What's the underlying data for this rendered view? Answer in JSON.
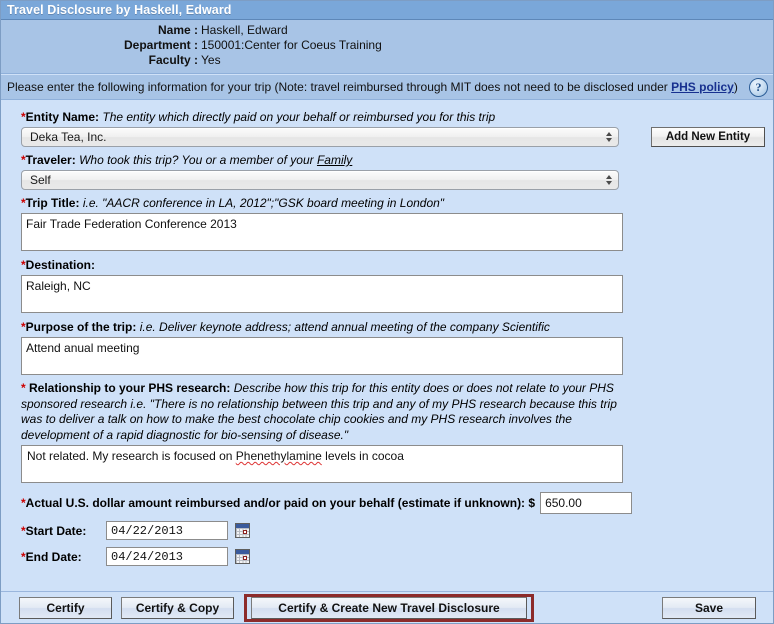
{
  "window": {
    "title": "Travel Disclosure by Haskell, Edward"
  },
  "header": {
    "rows": [
      {
        "label": "Name :",
        "value": "Haskell, Edward"
      },
      {
        "label": "Department :",
        "value": "150001:Center for Coeus Training"
      },
      {
        "label": "Faculty :",
        "value": "Yes"
      }
    ]
  },
  "instruction": {
    "prefix": "Please enter the following information for your trip (Note: travel reimbursed through MIT does not need to be disclosed under ",
    "link": "PHS policy",
    "suffix": ")",
    "help_icon": "question-mark-icon",
    "help_glyph": "?"
  },
  "form": {
    "entity": {
      "required": "*",
      "label": "Entity Name:",
      "hint": "The entity which directly paid on your behalf or reimbursed you for this trip",
      "value": "Deka Tea, Inc.",
      "options": [
        "Deka Tea, Inc."
      ],
      "add_button": "Add New Entity"
    },
    "traveler": {
      "required": "*",
      "label": "Traveler:",
      "hint_a": "Who took this trip? You or a member of your ",
      "hint_link": "Family",
      "value": "Self",
      "options": [
        "Self"
      ]
    },
    "trip_title": {
      "required": "*",
      "label": "Trip Title:",
      "hint": "i.e. \"AACR conference in LA, 2012\";\"GSK board meeting in London\"",
      "value": "Fair Trade Federation Conference 2013"
    },
    "destination": {
      "required": "*",
      "label": "Destination:",
      "hint": "",
      "value": "Raleigh, NC"
    },
    "purpose": {
      "required": "*",
      "label": "Purpose of the trip:",
      "hint": "i.e. Deliver keynote address; attend annual meeting of the company Scientific",
      "value": "Attend anual meeting"
    },
    "relationship": {
      "required": "*",
      "label": " Relationship to your PHS research:",
      "hint": "Describe how this trip for this entity does or does not relate to your PHS sponsored research i.e. \"There is no relationship between this trip and any of my PHS research because this trip was to deliver a talk on how to make the best chocolate chip cookies and my PHS research involves the development of a rapid diagnostic for bio-sensing of disease.\"",
      "value_pre": "Not related. My research is focused on ",
      "value_misspelled": "Phenethylamine",
      "value_post": " levels in cocoa"
    },
    "amount": {
      "required": "*",
      "label": "Actual U.S. dollar amount reimbursed and/or paid on your behalf (estimate if unknown): $",
      "value": "650.00"
    },
    "start_date": {
      "required": "*",
      "label": "Start Date:",
      "value": "04/22/2013",
      "calendar_icon": "calendar-icon"
    },
    "end_date": {
      "required": "*",
      "label": "End Date:",
      "value": "04/24/2013",
      "calendar_icon": "calendar-icon"
    }
  },
  "buttons": {
    "certify": "Certify",
    "certify_copy": "Certify & Copy",
    "certify_new": "Certify & Create  New Travel Disclosure",
    "save": "Save"
  },
  "colors": {
    "titlebar": "#7aa7d9",
    "header_block": "#a8c4e6",
    "form_background": "#cfe1f8",
    "required_asterisk": "#cc0000",
    "link": "#17308f",
    "highlight_border": "#8c2b2b"
  }
}
